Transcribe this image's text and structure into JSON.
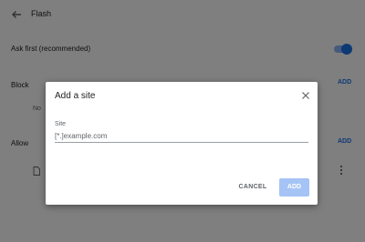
{
  "header": {
    "title": "Flash",
    "back_icon": "back-arrow-icon"
  },
  "ask_first": {
    "label": "Ask first (recommended)",
    "enabled": true,
    "accent": "#1a73e8"
  },
  "block": {
    "label": "Block",
    "add_label": "ADD",
    "empty_text": "No"
  },
  "allow": {
    "label": "Allow",
    "add_label": "ADD",
    "item_icon": "file-icon",
    "more_icon": "more-vert-icon"
  },
  "dialog": {
    "title": "Add a site",
    "close_icon": "close-icon",
    "field_label": "Site",
    "placeholder": "[*.]example.com",
    "value": "",
    "cancel_label": "CANCEL",
    "add_label": "ADD",
    "add_enabled": false
  }
}
